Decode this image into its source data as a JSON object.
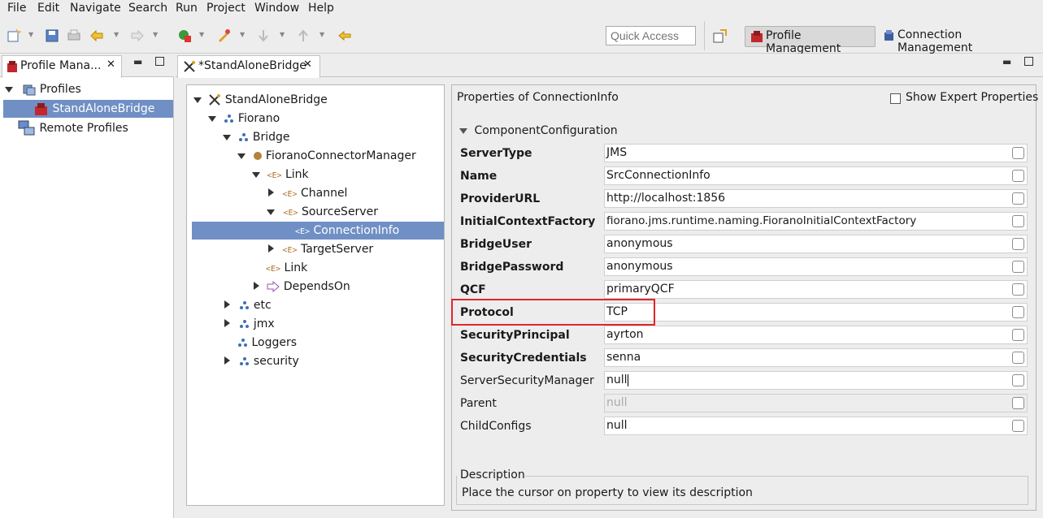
{
  "menu": [
    "File",
    "Edit",
    "Navigate",
    "Search",
    "Run",
    "Project",
    "Window",
    "Help"
  ],
  "toolbar": {
    "quick_access_placeholder": "Quick Access",
    "perspectives": [
      "Profile Management",
      "Connection Management"
    ]
  },
  "left_view": {
    "tab_title": "Profile Mana...",
    "tree": [
      {
        "label": "Profiles"
      },
      {
        "label": "StandAloneBridge"
      },
      {
        "label": "Remote Profiles"
      }
    ]
  },
  "editor": {
    "tab_title": "*StandAloneBridge",
    "tree": [
      {
        "label": "StandAloneBridge"
      },
      {
        "label": "Fiorano"
      },
      {
        "label": "Bridge"
      },
      {
        "label": "FioranoConnectorManager"
      },
      {
        "label": "Link"
      },
      {
        "label": "Channel"
      },
      {
        "label": "SourceServer"
      },
      {
        "label": "ConnectionInfo"
      },
      {
        "label": "TargetServer"
      },
      {
        "label": "Link"
      },
      {
        "label": "DependsOn"
      },
      {
        "label": "etc"
      },
      {
        "label": "jmx"
      },
      {
        "label": "Loggers"
      },
      {
        "label": "security"
      }
    ],
    "properties": {
      "title": "Properties of ConnectionInfo",
      "show_expert_label": "Show Expert Properties",
      "section": "ComponentConfiguration",
      "rows": [
        {
          "name": "ServerType",
          "value": "JMS"
        },
        {
          "name": "Name",
          "value": "SrcConnectionInfo"
        },
        {
          "name": "ProviderURL",
          "value": "http://localhost:1856"
        },
        {
          "name": "InitialContextFactory",
          "value": "fiorano.jms.runtime.naming.FioranoInitialContextFactory"
        },
        {
          "name": "BridgeUser",
          "value": "anonymous"
        },
        {
          "name": "BridgePassword",
          "value": "anonymous"
        },
        {
          "name": "QCF",
          "value": "primaryQCF"
        },
        {
          "name": "Protocol",
          "value": "TCP"
        },
        {
          "name": "SecurityPrincipal",
          "value": "ayrton"
        },
        {
          "name": "SecurityCredentials",
          "value": "senna"
        },
        {
          "name": "ServerSecurityManager",
          "value": "null"
        },
        {
          "name": "Parent",
          "value": "null"
        },
        {
          "name": "ChildConfigs",
          "value": "null"
        }
      ],
      "description_label": "Description",
      "description_text": "Place the cursor on property to view its description"
    }
  },
  "colors": {
    "selection": "#6f8fc5",
    "highlight_box": "#e0262a"
  }
}
